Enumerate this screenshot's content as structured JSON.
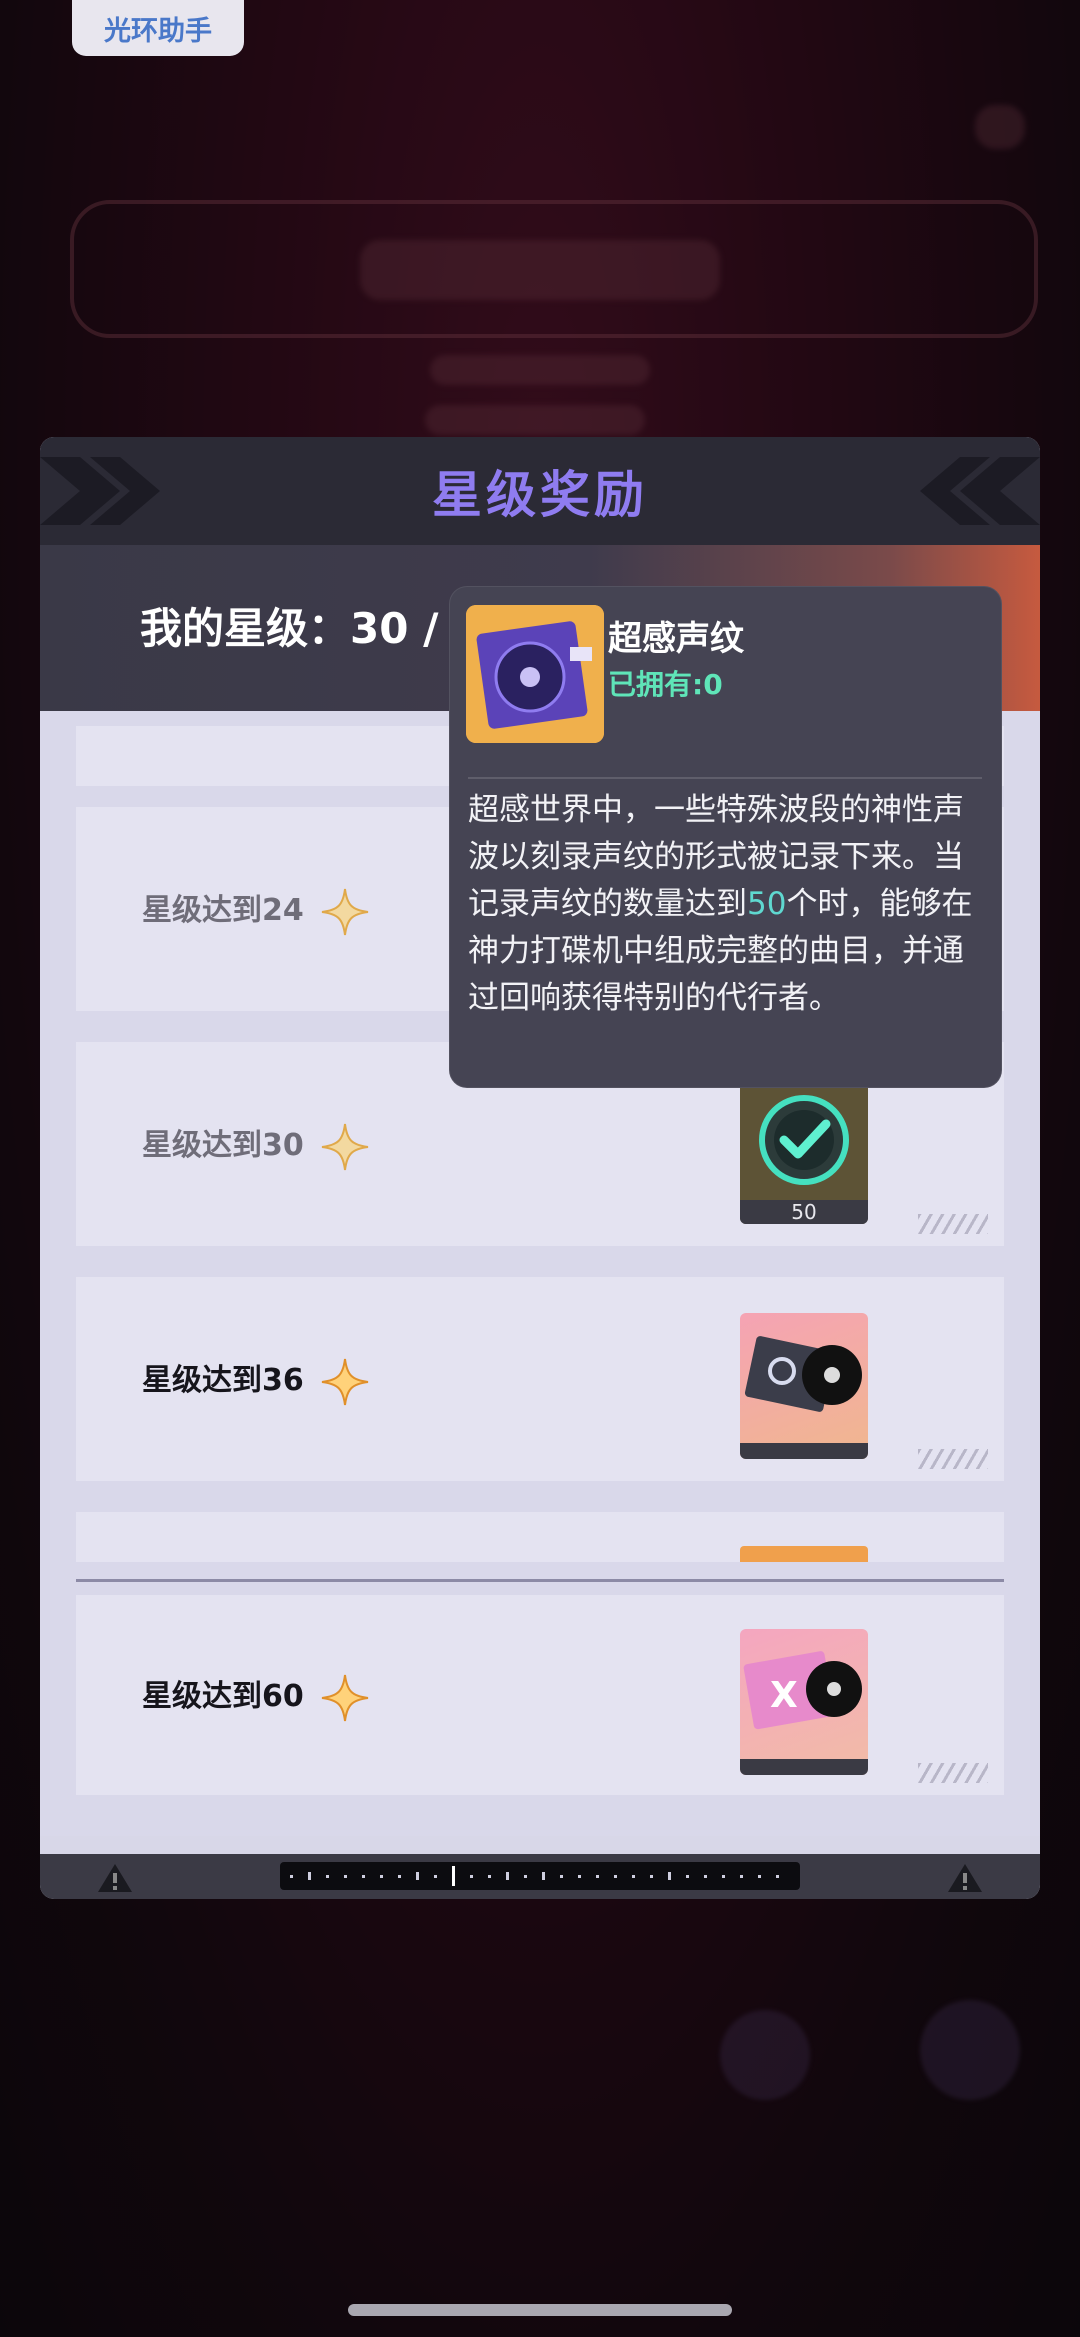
{
  "helper": {
    "label": "光环助手"
  },
  "panel": {
    "title": "星级奖励",
    "my_star_label": "我的星级：30 / "
  },
  "rewards": [
    {
      "label": "星级达到24",
      "state": "claimed"
    },
    {
      "label": "星级达到30",
      "state": "claimed",
      "item_count": "50"
    },
    {
      "label": "星级达到36",
      "state": "available"
    },
    {
      "label": "星级达到60",
      "state": "available"
    }
  ],
  "tooltip": {
    "name": "超感声纹",
    "owned": "已拥有:0",
    "desc_part1": "超感世界中，一些特殊波段的神性声波以刻录声纹的形式被记录下来。当记录声纹的数量达到",
    "desc_highlight": "50",
    "desc_part2": "个时，能够在神力打碟机中组成完整的曲目，并通过回响获得特别的代行者。"
  },
  "icons": {
    "sparkle": "sparkle-icon",
    "warning": "warning-icon",
    "vinyl": "vinyl-record-icon",
    "check": "check-icon"
  },
  "colors": {
    "title": "#8f7cf0",
    "owned": "#5fe5b8",
    "highlight": "#5fd8d0",
    "sparkle": "#f0b04c"
  }
}
